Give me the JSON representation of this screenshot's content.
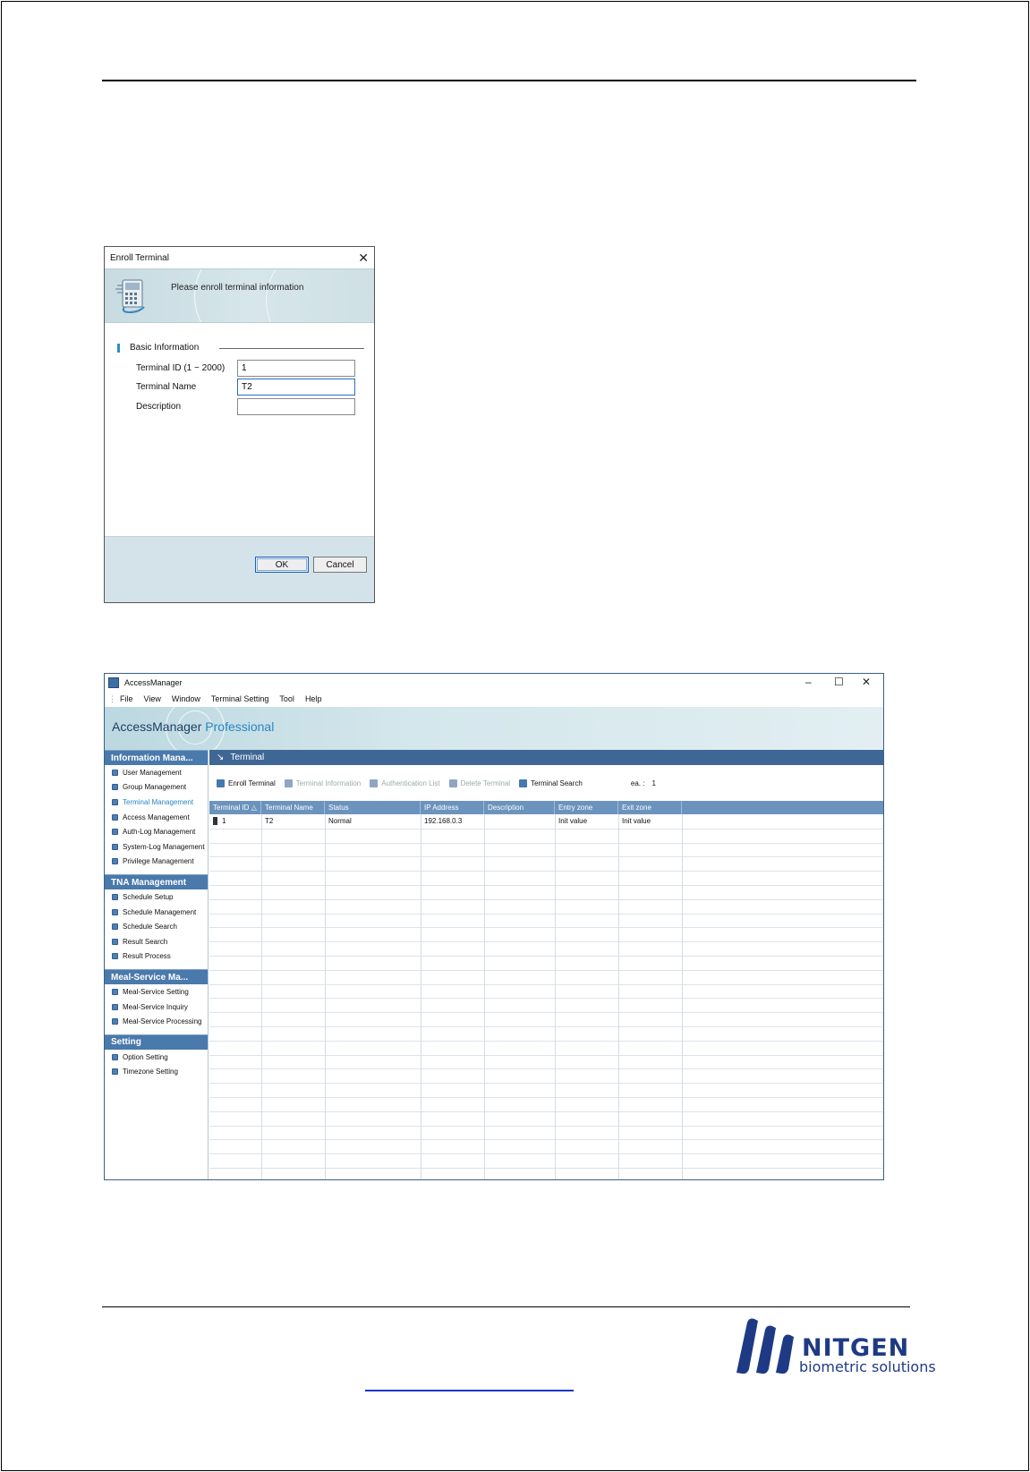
{
  "dialog": {
    "title": "Enroll Terminal",
    "banner_text": "Please enroll terminal information",
    "section_title": "Basic Information",
    "fields": [
      {
        "label": "Terminal ID (1 ~ 2000)",
        "value": "1"
      },
      {
        "label": "Terminal Name",
        "value": "T2"
      },
      {
        "label": "Description",
        "value": ""
      }
    ],
    "ok_label": "OK",
    "cancel_label": "Cancel"
  },
  "app": {
    "title": "AccessManager",
    "menu": [
      "File",
      "View",
      "Window",
      "Terminal Setting",
      "Tool",
      "Help"
    ],
    "brand_main": "AccessManager",
    "brand_pro": "Professional",
    "sidebar": [
      {
        "heading": "Information Mana...",
        "items": [
          "User Management",
          "Group Management",
          "Terminal Management",
          "Access Management",
          "Auth-Log Management",
          "System-Log Management",
          "Privilege Management"
        ]
      },
      {
        "heading": "TNA Management",
        "items": [
          "Schedule Setup",
          "Schedule Management",
          "Schedule Search",
          "Result Search",
          "Result Process"
        ]
      },
      {
        "heading": "Meal-Service Ma...",
        "items": [
          "Meal-Service Setting",
          "Meal-Service Inquiry",
          "Meal-Service Processing"
        ]
      },
      {
        "heading": "Setting",
        "items": [
          "Option Setting",
          "Timezone Setting"
        ]
      }
    ],
    "active_item": "Terminal Management",
    "content_title": "Terminal",
    "toolbar": [
      {
        "label": "Enroll Terminal",
        "enabled": true
      },
      {
        "label": "Terminal Information",
        "enabled": false
      },
      {
        "label": "Authentication List",
        "enabled": false
      },
      {
        "label": "Delete Terminal",
        "enabled": false
      },
      {
        "label": "Terminal Search",
        "enabled": true
      }
    ],
    "count_label": "ea. :",
    "count_value": "1",
    "columns": [
      "Terminal ID",
      "Terminal Name",
      "Status",
      "IP Address",
      "Description",
      "Entry zone",
      "Exit zone"
    ],
    "sort_indicator": "△",
    "rows": [
      [
        "1",
        "T2",
        "Normal",
        "192.168.0.3",
        "",
        "Init value",
        "Init value"
      ]
    ]
  },
  "footer": {
    "logo_word": "NITGEN",
    "logo_sub": "biometric solutions"
  }
}
